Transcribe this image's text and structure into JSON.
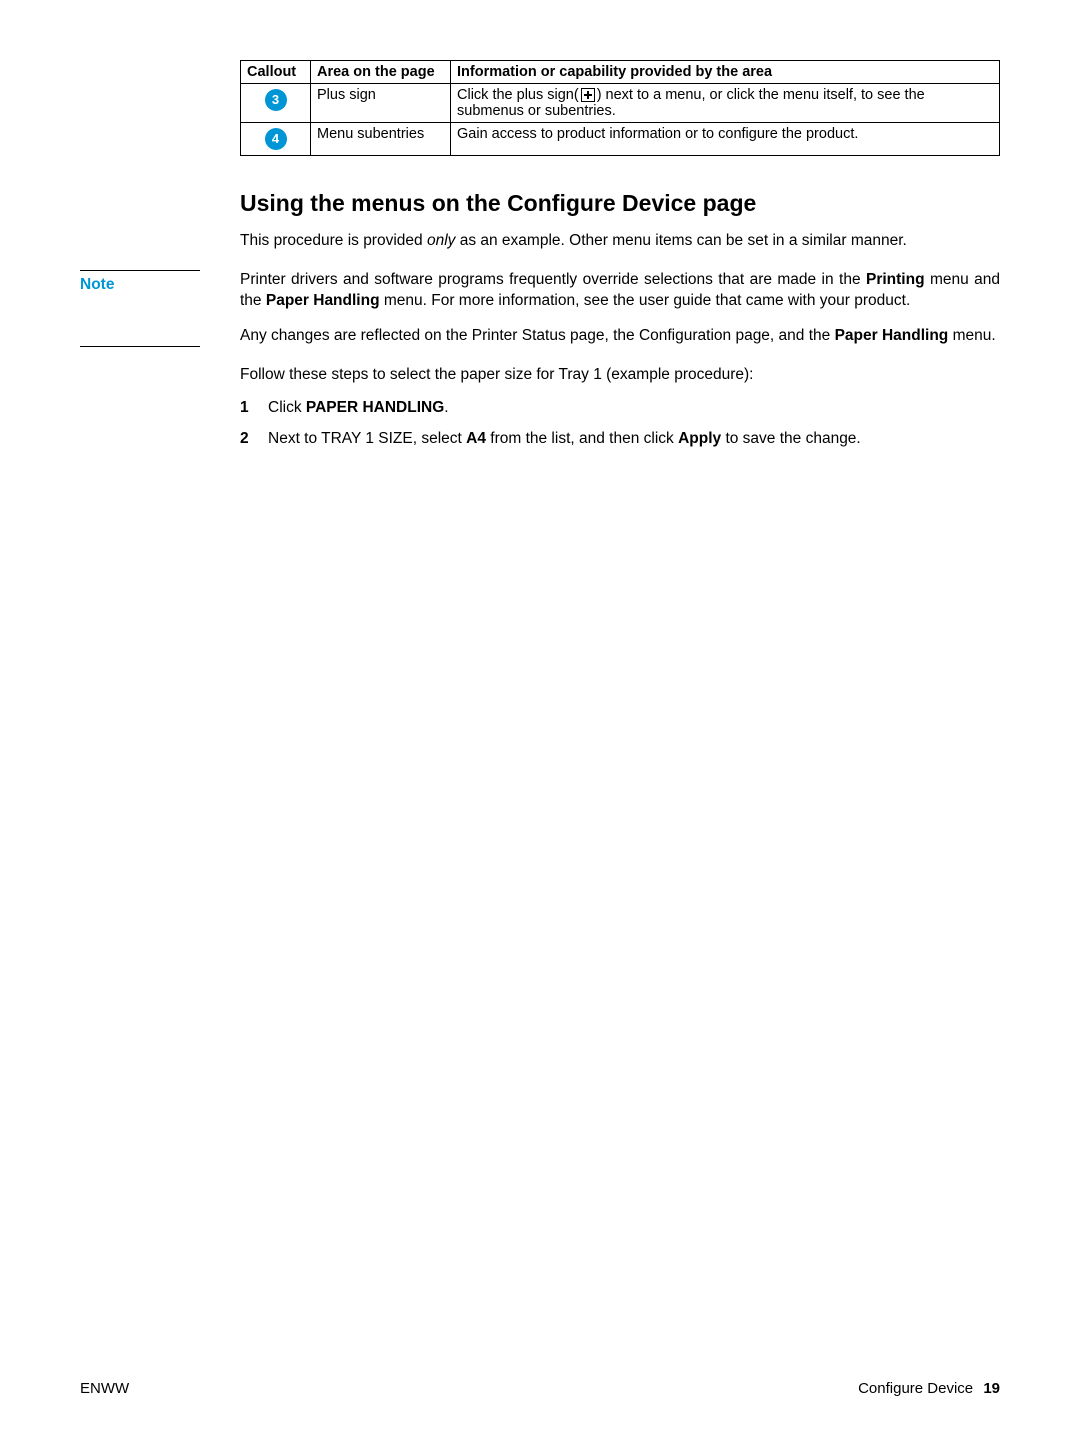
{
  "table": {
    "headers": {
      "callout": "Callout",
      "area": "Area on the page",
      "info": "Information or capability provided by the area"
    },
    "rows": [
      {
        "num": "3",
        "area": "Plus sign",
        "info_before": "Click the plus sign(",
        "info_after": ") next to a menu, or click the menu itself, to see the submenus or subentries."
      },
      {
        "num": "4",
        "area": "Menu subentries",
        "info": "Gain access to product information or to configure the product."
      }
    ]
  },
  "heading": "Using the menus on the Configure Device page",
  "intro_before": "This procedure is provided ",
  "intro_italic": "only",
  "intro_after": " as an example. Other menu items can be set in a similar manner.",
  "note": {
    "label": "Note",
    "p1_a": "Printer drivers and software programs frequently override selections that are made in the ",
    "p1_b": "Printing",
    "p1_c": " menu and the ",
    "p1_d": "Paper Handling",
    "p1_e": " menu. For more information, see the user guide that came with your product.",
    "p2_a": "Any changes are reflected on the Printer Status page, the Configuration page, and the ",
    "p2_b": "Paper Handling",
    "p2_c": " menu."
  },
  "follow": "Follow these steps to select the paper size for Tray 1 (example procedure):",
  "steps": [
    {
      "num": "1",
      "pre": "Click ",
      "bold": "PAPER HANDLING",
      "post": "."
    },
    {
      "num": "2",
      "pre": "Next to TRAY 1 SIZE, select ",
      "bold": "A4",
      "mid": " from the list, and then click ",
      "bold2": "Apply",
      "post": " to save the change."
    }
  ],
  "footer": {
    "left": "ENWW",
    "right_text": "Configure Device",
    "right_page": "19"
  }
}
